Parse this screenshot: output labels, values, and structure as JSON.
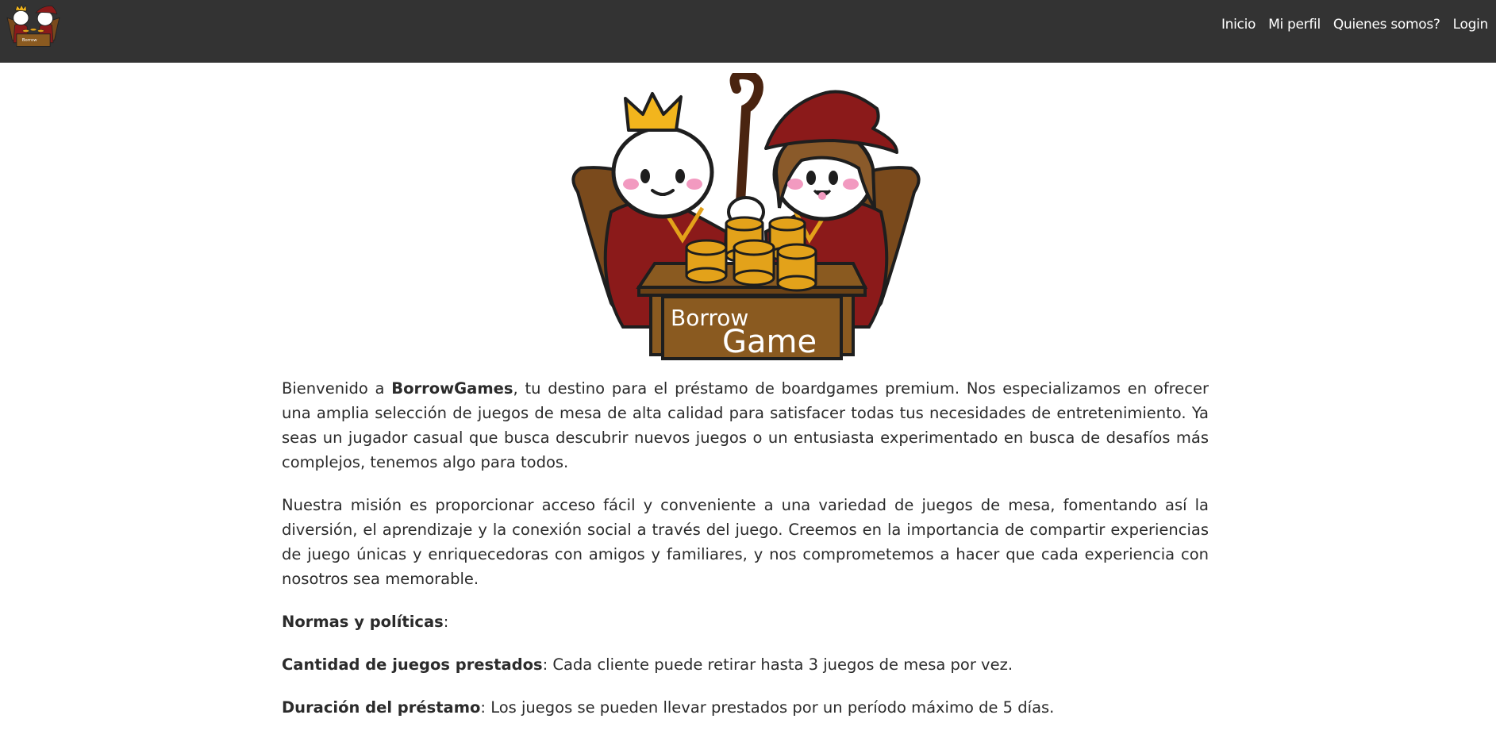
{
  "navbar": {
    "links": [
      "Inicio",
      "Mi perfil",
      "Quienes somos?",
      "Login"
    ]
  },
  "logo": {
    "text_line1": "Borrow",
    "text_line2": "Game"
  },
  "intro": {
    "prefix": "Bienvenido a ",
    "brand": "BorrowGames",
    "suffix": ", tu destino para el préstamo de boardgames premium. Nos especializamos en ofrecer una amplia selección de juegos de mesa de alta calidad para satisfacer todas tus necesidades de entretenimiento. Ya seas un jugador casual que busca descubrir nuevos juegos o un entusiasta experimentado en busca de desafíos más complejos, tenemos algo para todos."
  },
  "mission": {
    "text": "Nuestra misión es proporcionar acceso fácil y conveniente a una variedad de juegos de mesa, fomentando así la diversión, el aprendizaje y la conexión social a través del juego. Creemos en la importancia de compartir experiencias de juego únicas y enriquecedoras con amigos y familiares, y nos comprometemos a hacer que cada experiencia con nosotros sea memorable."
  },
  "rules": {
    "heading": "Normas y políticas",
    "heading_suffix": ":",
    "items": [
      {
        "label": "Cantidad de juegos prestados",
        "text": ": Cada cliente puede retirar hasta 3 juegos de mesa por vez."
      },
      {
        "label": "Duración del préstamo",
        "text": ": Los juegos se pueden llevar prestados por un período máximo de 5 días."
      }
    ]
  },
  "colors": {
    "navbar_bg": "#333333",
    "robe_red": "#8b1a1a",
    "coin_gold": "#e3a21a",
    "desk_brown": "#8a5a20"
  }
}
